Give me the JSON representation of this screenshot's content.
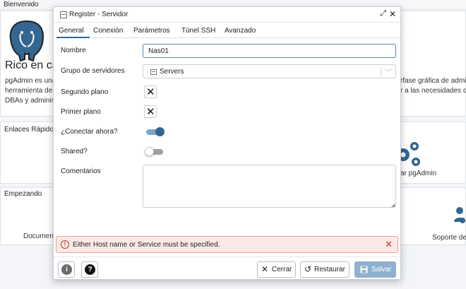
{
  "background": {
    "header_title": "Bienvenido",
    "welcome_title": "Rico en ca",
    "welcome_lines": [
      "pgAdmin es una",
      "herramienta de",
      "DBAs y adminis"
    ],
    "right_lines": [
      "rfase gráfica de admi",
      "r a las necesidades d"
    ],
    "quick_links_title": "Enlaces Rápido",
    "configure_label": "ar pgAdmin",
    "getting_started_title": "Empezando",
    "documentation_label": "Documen",
    "support_label": "Soporte de",
    "colors": {
      "elephant_blue": "#336791",
      "gear_blue": "#326690"
    }
  },
  "dialog": {
    "title": "Register - Servidor",
    "tabs": [
      "General",
      "Conexión",
      "Parámetros",
      "Túnel SSH",
      "Avanzado"
    ],
    "active_tab": "General",
    "fields": {
      "name_label": "Nombre",
      "name_value": "Nas01",
      "group_label": "Grupo de servidores",
      "group_value": "Servers",
      "background_label": "Segundo plano",
      "foreground_label": "Primer plano",
      "connect_now_label": "¿Conectar ahora?",
      "shared_label": "Shared?",
      "comments_label": "Comentarios",
      "comments_value": ""
    },
    "error_message": "Either Host name or Service must be specified.",
    "footer": {
      "cancel_label": "Cerrar",
      "reset_label": "Restaurar",
      "save_label": "Salvar"
    },
    "colors": {
      "accent": "#326690",
      "error_bg": "#fbe9e7",
      "error_border": "#e8a09a",
      "save_disabled": "#8fb1cf"
    }
  }
}
